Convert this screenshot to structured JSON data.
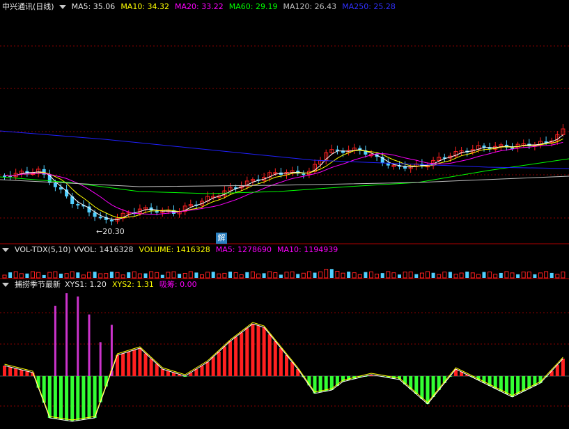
{
  "price_panel": {
    "title": "中兴通讯(日线)",
    "ma": [
      {
        "label": "MA5: 35.06",
        "color": "#ffffff"
      },
      {
        "label": "MA10: 34.32",
        "color": "#ffff00"
      },
      {
        "label": "MA20: 33.22",
        "color": "#ff00ff"
      },
      {
        "label": "MA60: 29.19",
        "color": "#00ff00"
      },
      {
        "label": "MA120: 26.43",
        "color": "#c0c0c0"
      },
      {
        "label": "MA250: 25.28",
        "color": "#0000ff"
      }
    ],
    "low_label": "←20.30",
    "jie_label": "解"
  },
  "volume_panel": {
    "title": "VOL-TDX(5,10)",
    "items": [
      {
        "label": "VVOL: 1416328",
        "color": "#e6e6e6"
      },
      {
        "label": "VOLUME: 1416328",
        "color": "#ffff00"
      },
      {
        "label": "MA5: 1278690",
        "color": "#ff00ff"
      },
      {
        "label": "MA10: 1194939",
        "color": "#ff00ff"
      }
    ]
  },
  "indicator_panel": {
    "title": "捕捞季节最新",
    "items": [
      {
        "label": "XYS1: 1.20",
        "color": "#e6e6e6"
      },
      {
        "label": "XYS2: 1.31",
        "color": "#ffff00"
      },
      {
        "label": "吸筹: 0.00",
        "color": "#ff00ff"
      }
    ]
  },
  "colors": {
    "up": "#ff2020",
    "down": "#50d0ff",
    "grid": "#8b0000",
    "osc_pos": "#ff2020",
    "osc_neg": "#33ff33",
    "accumulate": "#cc33cc"
  }
}
